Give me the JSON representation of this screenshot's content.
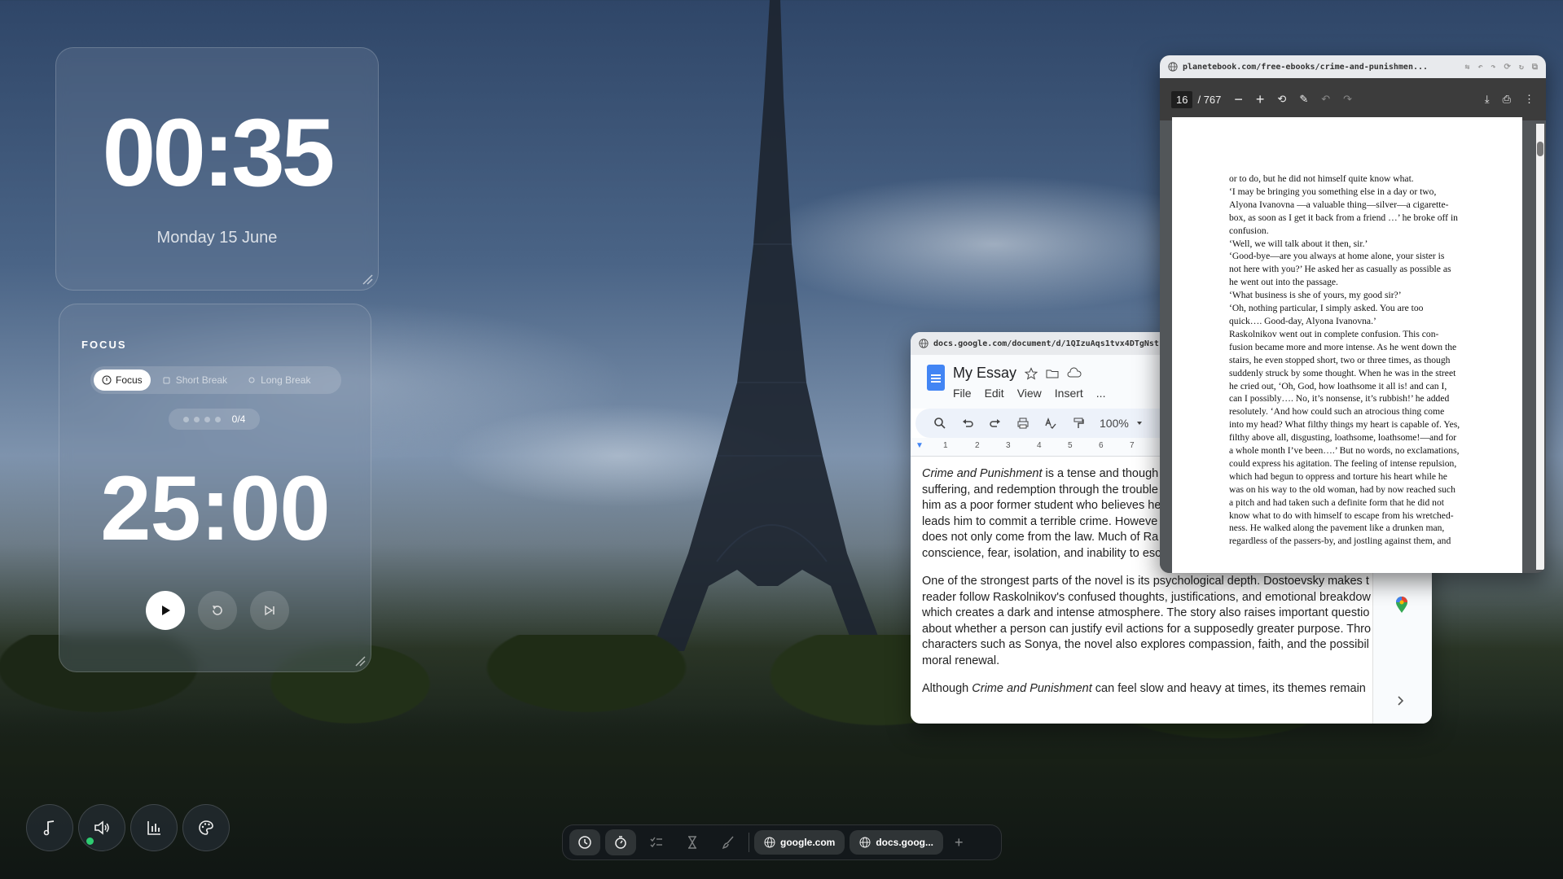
{
  "clock": {
    "time": "00:35",
    "date": "Monday 15 June"
  },
  "pomodoro": {
    "label": "FOCUS",
    "modes": [
      "Focus",
      "Short Break",
      "Long Break"
    ],
    "active_mode": "Focus",
    "sessions": "0/4",
    "timer": "25:00"
  },
  "dock": {
    "tabs": [
      "google.com",
      "docs.goog..."
    ],
    "icons": [
      "clock-icon",
      "stopwatch-icon",
      "checklist-icon",
      "hourglass-icon",
      "brush-icon"
    ]
  },
  "bottom_left_buttons": [
    "music-note-icon",
    "volume-icon",
    "chart-icon",
    "palette-icon"
  ],
  "docs_window": {
    "url": "docs.google.com/document/d/1QIzuAqs1tvx4DTgNst",
    "title": "My Essay",
    "menu": [
      "File",
      "Edit",
      "View",
      "Insert",
      "..."
    ],
    "zoom": "100%",
    "ruler_ticks": [
      "1",
      "2",
      "3",
      "4",
      "5",
      "6",
      "7"
    ],
    "paragraphs": [
      {
        "lines": [
          [
            "Crime and Punishment",
            " is a tense and though"
          ],
          [
            "",
            "suffering, and redemption through the trouble"
          ],
          [
            "",
            "him as a poor former student who believes he"
          ],
          [
            "",
            "leads him to commit a terrible crime. Howeve"
          ],
          [
            "",
            "does not only come from the law. Much of Ra"
          ],
          [
            "",
            "conscience, fear, isolation, and inability to escape what he has done."
          ]
        ]
      },
      {
        "lines": [
          [
            "",
            "One of the strongest parts of the novel is its psychological depth. Dostoevsky makes t"
          ],
          [
            "",
            "reader follow Raskolnikov's confused thoughts, justifications, and emotional breakdow"
          ],
          [
            "",
            "which creates a dark and intense atmosphere. The story also raises important questio"
          ],
          [
            "",
            "about whether a person can justify evil actions for a supposedly greater purpose. Thro"
          ],
          [
            "",
            "characters such as Sonya, the novel also explores compassion, faith, and the possibil"
          ],
          [
            "",
            "moral renewal."
          ]
        ]
      },
      {
        "lines": [
          [
            "",
            "Although "
          ],
          [
            "Crime and Punishment",
            " can feel slow and heavy at times, its themes remain"
          ]
        ]
      }
    ]
  },
  "pdf_window": {
    "url": "planetebook.com/free-ebooks/crime-and-punishmen...",
    "page_current": "16",
    "page_total": "/ 767",
    "lines": [
      "or to do, but he did not himself quite know what.",
      "   ‘I may be bringing you something else in a day or two,",
      "Alyona Ivanovna —a valuable thing—silver—a cigarette-",
      "box, as soon as I get it back from a friend …’ he broke off in",
      "confusion.",
      "   ‘Well, we will talk about it then, sir.’",
      "   ‘Good-bye—are you always at home alone, your sister is",
      "not here with you?’ He asked her as casually as possible as",
      "he went out into the passage.",
      "   ‘What business is she of yours, my good sir?’",
      "   ‘Oh, nothing particular, I simply asked. You are too",
      "quick…. Good-day, Alyona Ivanovna.’",
      "   Raskolnikov went out in complete confusion. This con-",
      "fusion became more and more intense. As he went down the",
      "stairs, he even stopped short, two or three times, as though",
      "suddenly struck by some thought. When he was in the street",
      "he cried out, ‘Oh, God, how loathsome it all is! and can I,",
      "can I possibly…. No, it’s nonsense, it’s rubbish!’ he added",
      "resolutely. ‘And how could such an atrocious thing come",
      "into my head? What filthy things my heart is capable of. Yes,",
      "filthy above all, disgusting, loathsome, loathsome!—and for",
      "a whole month I’ve been….’ But no words, no exclamations,",
      "could express his agitation. The feeling of intense repulsion,",
      "which had begun to oppress and torture his heart while he",
      "was on his way to the old woman, had by now reached such",
      "a pitch and had taken such a definite form that he did not",
      "know what to do with himself to escape from his wretched-",
      "ness. He walked along the pavement like a drunken man,",
      "regardless of the passers-by, and jostling against them, and"
    ]
  }
}
